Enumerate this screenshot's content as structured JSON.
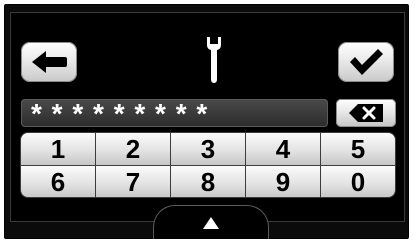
{
  "header": {
    "back_icon": "arrow-left-icon",
    "tool_icon": "wrench-icon",
    "confirm_icon": "checkmark-icon"
  },
  "pin": {
    "masked_value": "* * * * * * * * *"
  },
  "delete_icon": "backspace-icon",
  "keypad": {
    "keys": [
      "1",
      "2",
      "3",
      "4",
      "5",
      "6",
      "7",
      "8",
      "9",
      "0"
    ]
  },
  "footer": {
    "expand_icon": "triangle-up-icon"
  }
}
